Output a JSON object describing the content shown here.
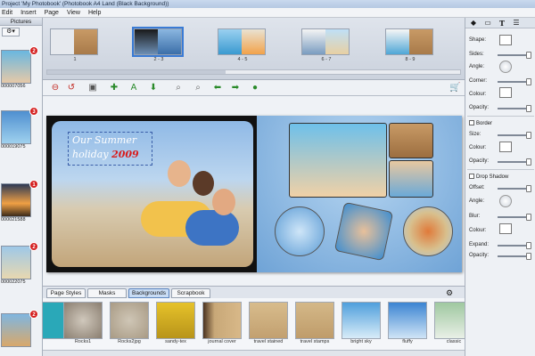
{
  "window": {
    "title": "Project 'My Photobook' (Photobook A4 Land (Black Background))"
  },
  "menu": [
    "Edit",
    "Insert",
    "Page",
    "View",
    "Help"
  ],
  "pictures_panel": {
    "header": "Pictures",
    "items": [
      {
        "caption": "000007056",
        "badge": "2"
      },
      {
        "caption": "000019075",
        "badge": "3"
      },
      {
        "caption": "000021588",
        "badge": "1"
      },
      {
        "caption": "000022075",
        "badge": "2"
      },
      {
        "caption": "",
        "badge": "2"
      }
    ]
  },
  "page_strip": [
    {
      "label": "1"
    },
    {
      "label": "2 - 3"
    },
    {
      "label": "4 - 5"
    },
    {
      "label": "6 - 7"
    },
    {
      "label": "8 - 9"
    }
  ],
  "canvas": {
    "title_line1": "Our Summer",
    "title_line2": "holiday",
    "title_year": "2009"
  },
  "bottom_tabs": [
    "Page Styles",
    "Masks",
    "Backgrounds",
    "Scrapbook"
  ],
  "backgrounds": [
    {
      "name": ""
    },
    {
      "name": "Rocks1"
    },
    {
      "name": "Rocks2jpg"
    },
    {
      "name": "sandy-tex"
    },
    {
      "name": "journal cover"
    },
    {
      "name": "travel stained"
    },
    {
      "name": "travel stamps"
    },
    {
      "name": "bright sky"
    },
    {
      "name": "fluffy"
    },
    {
      "name": "classic"
    }
  ],
  "properties": {
    "shape": "Shape:",
    "sides": "Sides:",
    "angle": "Angle:",
    "corner": "Corner:",
    "colour": "Colour:",
    "opacity": "Opacity:",
    "border": "Border",
    "size": "Size:",
    "border_colour": "Colour:",
    "border_opacity": "Opacity:",
    "drop_shadow": "Drop Shadow",
    "offset": "Offset:",
    "shadow_angle": "Angle:",
    "blur": "Blur:",
    "shadow_colour": "Colour:",
    "expand": "Expand:",
    "shadow_opacity": "Opacity:"
  }
}
